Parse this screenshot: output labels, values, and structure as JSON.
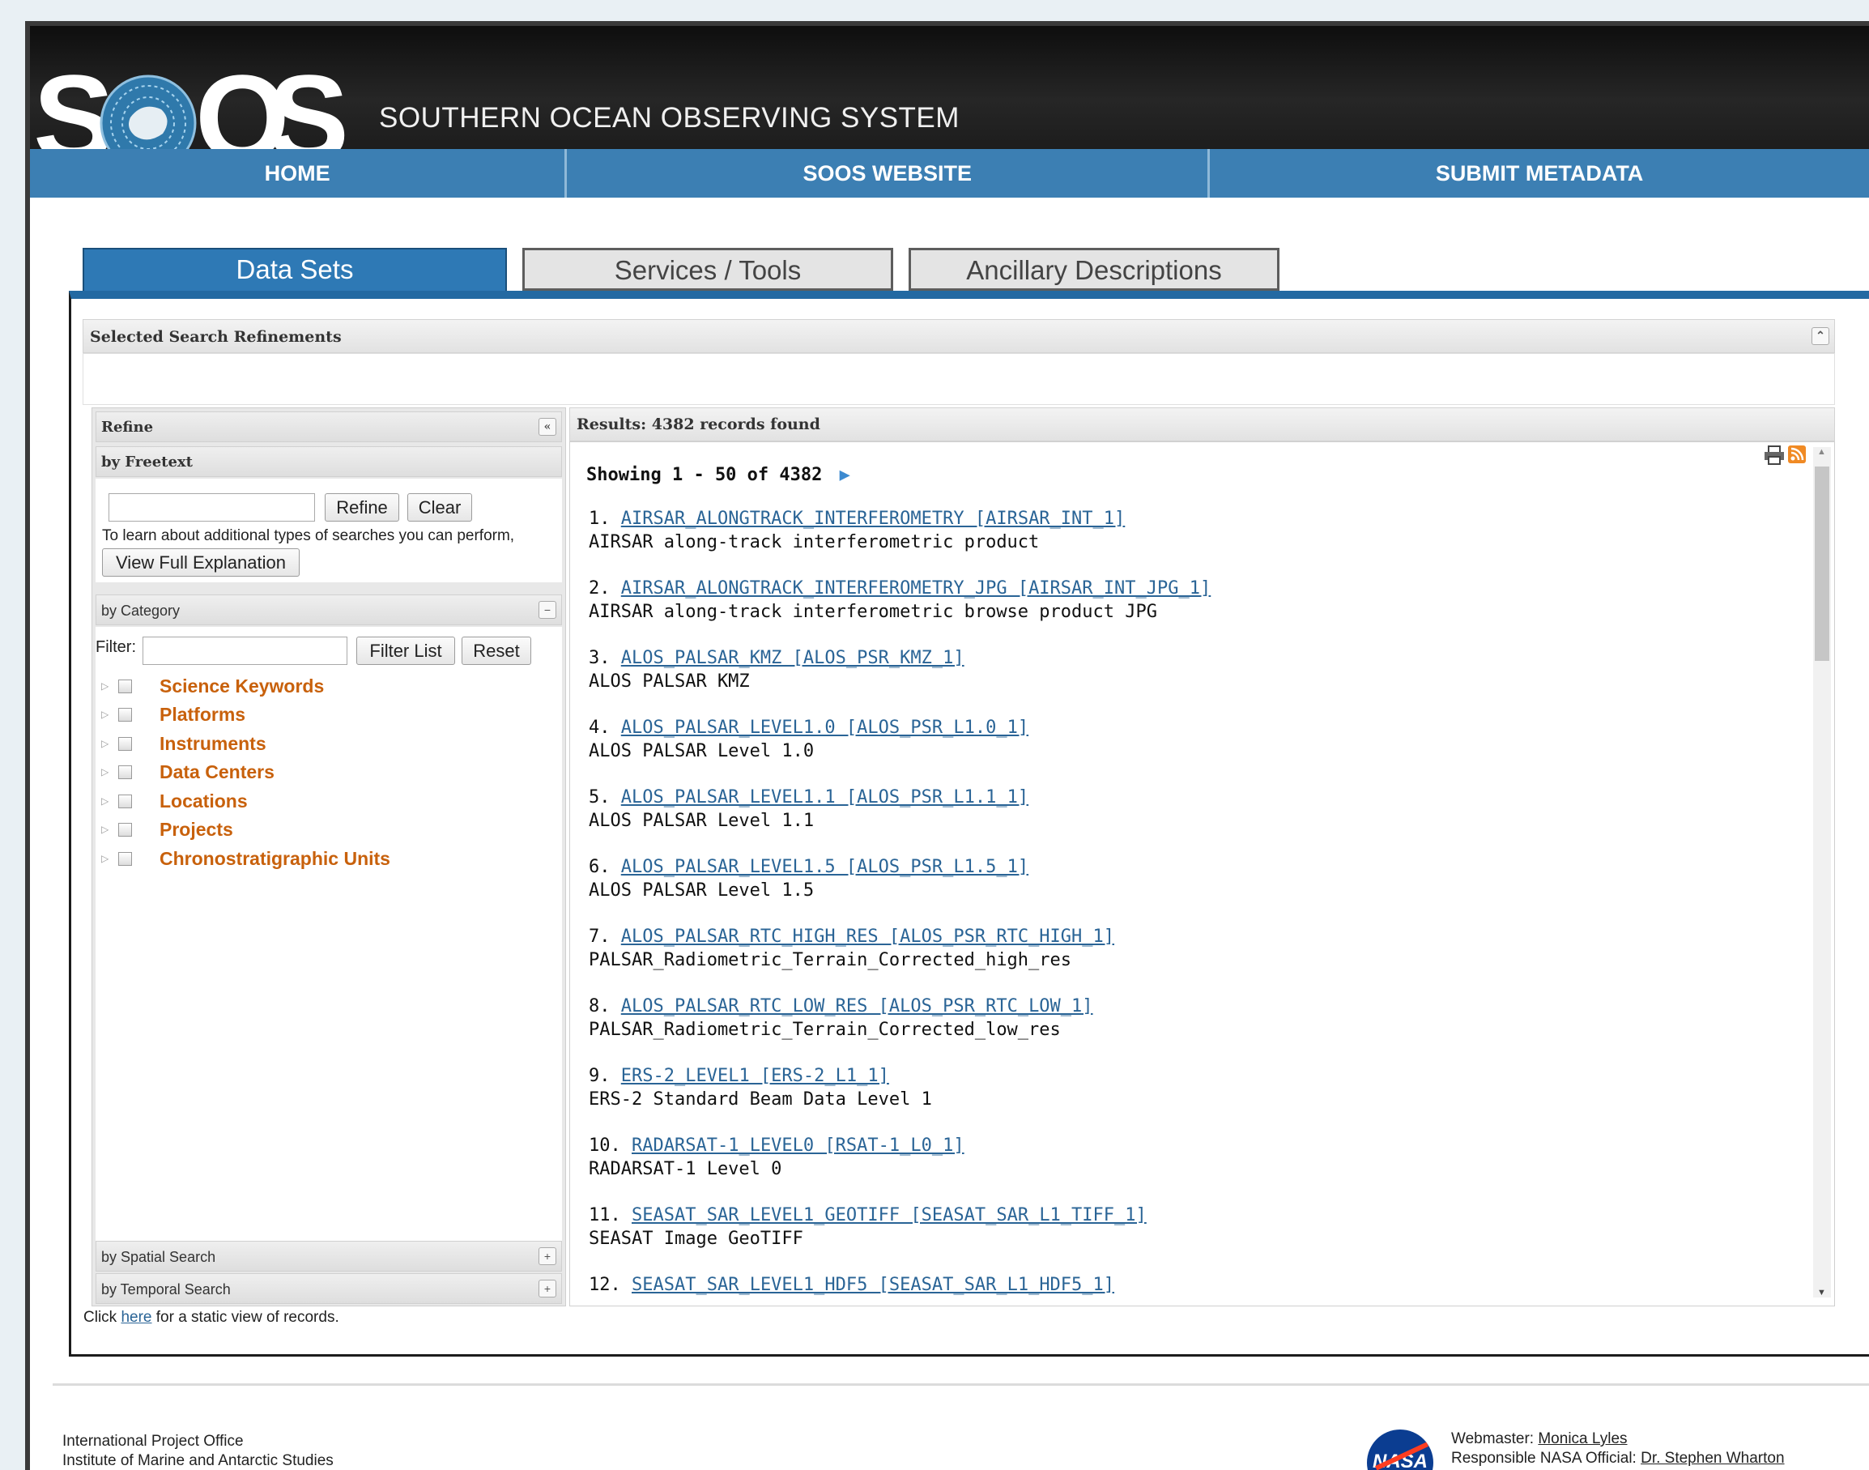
{
  "header": {
    "logo_letters": [
      "S",
      "O",
      "S"
    ],
    "site_title": "SOUTHERN OCEAN OBSERVING SYSTEM"
  },
  "nav": {
    "items": [
      "HOME",
      "SOOS WEBSITE",
      "SUBMIT METADATA"
    ]
  },
  "tabs": [
    "Data Sets",
    "Services / Tools",
    "Ancillary Descriptions"
  ],
  "refinements": {
    "title": "Selected Search Refinements"
  },
  "refine": {
    "title": "Refine",
    "freetext": {
      "title": "by Freetext",
      "refine_button": "Refine",
      "clear_button": "Clear",
      "hint": "To learn about additional types of searches you can perform,",
      "explain_button": "View Full Explanation"
    },
    "category": {
      "title": "by Category",
      "filter_label": "Filter:",
      "filter_button": "Filter List",
      "reset_button": "Reset",
      "items": [
        "Science Keywords",
        "Platforms",
        "Instruments",
        "Data Centers",
        "Locations",
        "Projects",
        "Chronostratigraphic Units"
      ]
    },
    "spatial": "by Spatial Search",
    "temporal": "by Temporal Search"
  },
  "results": {
    "header": "Results: 4382 records found",
    "showing": "Showing 1 - 50 of 4382",
    "records": [
      {
        "num": "1.",
        "link": "AIRSAR_ALONGTRACK_INTERFEROMETRY [AIRSAR_INT_1]",
        "desc": "AIRSAR along-track interferometric product"
      },
      {
        "num": "2.",
        "link": "AIRSAR_ALONGTRACK_INTERFEROMETRY_JPG [AIRSAR_INT_JPG_1]",
        "desc": "AIRSAR along-track interferometric browse product JPG"
      },
      {
        "num": "3.",
        "link": "ALOS_PALSAR_KMZ [ALOS_PSR_KMZ_1]",
        "desc": "ALOS PALSAR KMZ"
      },
      {
        "num": "4.",
        "link": "ALOS_PALSAR_LEVEL1.0 [ALOS_PSR_L1.0_1]",
        "desc": "ALOS PALSAR Level 1.0"
      },
      {
        "num": "5.",
        "link": "ALOS_PALSAR_LEVEL1.1 [ALOS_PSR_L1.1_1]",
        "desc": "ALOS PALSAR Level 1.1"
      },
      {
        "num": "6.",
        "link": "ALOS_PALSAR_LEVEL1.5 [ALOS_PSR_L1.5_1]",
        "desc": "ALOS PALSAR Level 1.5"
      },
      {
        "num": "7.",
        "link": "ALOS_PALSAR_RTC_HIGH_RES [ALOS_PSR_RTC_HIGH_1]",
        "desc": "PALSAR_Radiometric_Terrain_Corrected_high_res"
      },
      {
        "num": "8.",
        "link": "ALOS_PALSAR_RTC_LOW_RES [ALOS_PSR_RTC_LOW_1]",
        "desc": "PALSAR_Radiometric_Terrain_Corrected_low_res"
      },
      {
        "num": "9.",
        "link": "ERS-2_LEVEL1 [ERS-2_L1_1]",
        "desc": "ERS-2 Standard Beam Data Level 1"
      },
      {
        "num": "10.",
        "link": "RADARSAT-1_LEVEL0 [RSAT-1_L0_1]",
        "desc": "RADARSAT-1 Level 0"
      },
      {
        "num": "11.",
        "link": "SEASAT_SAR_LEVEL1_GEOTIFF [SEASAT_SAR_L1_TIFF_1]",
        "desc": "SEASAT Image GeoTIFF"
      },
      {
        "num": "12.",
        "link": "SEASAT_SAR_LEVEL1_HDF5 [SEASAT_SAR_L1_HDF5_1]",
        "desc": ""
      }
    ]
  },
  "static_view": {
    "prefix": "Click ",
    "link": "here",
    "suffix": " for a static view of records."
  },
  "footer": {
    "left_lines": [
      "International Project Office",
      "Institute of Marine and Antarctic Studies"
    ],
    "nasa_logo": "NASA",
    "webmaster_label": "Webmaster: ",
    "webmaster_name": "Monica Lyles",
    "official_label": "Responsible NASA Official: ",
    "official_name": "Dr. Stephen Wharton"
  },
  "colors": {
    "nav": "#3c7fb3",
    "tab_active": "#2e79b5",
    "category": "#c8610c",
    "link": "#2a6496"
  },
  "icons": [
    "print-icon",
    "rss-icon",
    "next-page-icon",
    "collapse-up-icon",
    "collapse-left-icon",
    "minus-icon",
    "plus-icon"
  ]
}
